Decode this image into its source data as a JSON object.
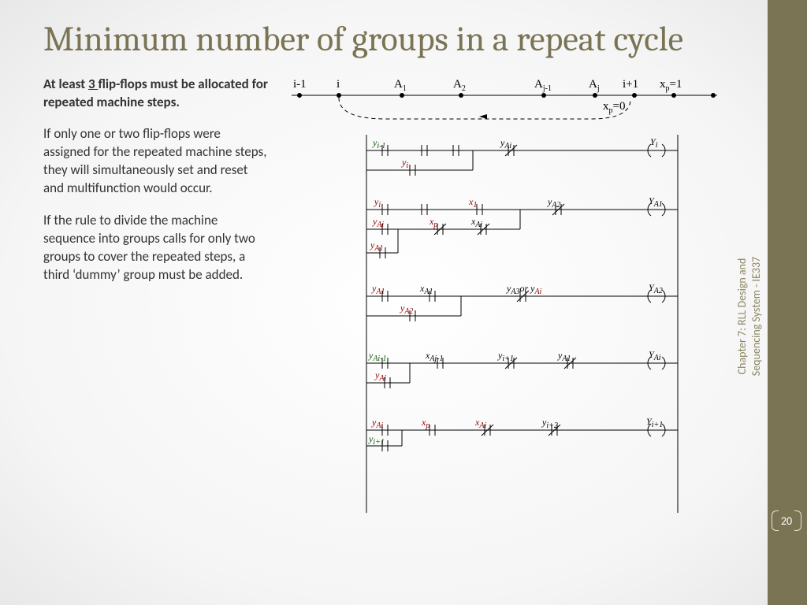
{
  "title": "Minimum number of groups in a repeat cycle",
  "text": {
    "lead_pre": "At least ",
    "lead_num": "3 ",
    "lead_post": "flip-flops must be allocated for repeated machine steps.",
    "p2": "If only one or two flip-flops were assigned for the repeated machine steps, they will simultaneously set and reset and multifunction would occur.",
    "p3": "If the rule to divide the machine sequence into groups calls for only two groups to cover the  repeated steps, a third ‘dummy’ group must be added."
  },
  "timeline": {
    "n0": "i-1",
    "n1": "i",
    "n2": "A",
    "s2": "1",
    "n3": "A",
    "s3": "2",
    "n4": "A",
    "s4": "j-1",
    "n5": "A",
    "s5": "j",
    "n6": "i+1",
    "n7": "x",
    "s7": "p",
    "eq7": "=1",
    "xp0": "x",
    "xp0s": "p",
    "xp0eq": "=0"
  },
  "rungs": {
    "r1": {
      "a": "y",
      "as": "i-1",
      "b": "y",
      "bs": "i",
      "c": "y",
      "cs": "Ai",
      "out": "Y",
      "outs": "i"
    },
    "r2": {
      "a": "y",
      "as": "i",
      "b": "x",
      "bs": "1",
      "c": "y",
      "cs": "A2",
      "out": "Y",
      "outs": "A1",
      "a2": "y",
      "a2s": "Ai",
      "b2": "x",
      "b2s": "p",
      "c2": "x",
      "c2s": "Ai",
      "a3": "y",
      "a3s": "A1"
    },
    "r3": {
      "a": "y",
      "as": "A1",
      "b": "x",
      "bs": "A1",
      "c": "y",
      "cs": "A3",
      "c2": "or y",
      "c2s": "Ai",
      "out": "Y",
      "outs": "A2",
      "a2": "y",
      "a2s": "A2"
    },
    "r4": {
      "a": "y",
      "as": "Ai-1",
      "b": "x",
      "bs": "Aj-1",
      "c": "y",
      "cs": "i+1",
      "d": "y",
      "ds": "A1",
      "out": "Y",
      "outs": "Ai",
      "a2": "y",
      "a2s": "Ai"
    },
    "r5": {
      "a": "y",
      "as": "Ai",
      "b": "x",
      "bs": "p",
      "c": "x",
      "cs": "Ai",
      "d": "y",
      "ds": "i+2",
      "out": "Y",
      "outs": "i+1",
      "a2": "y",
      "a2s": "i+1"
    }
  },
  "sidebar": {
    "line1": "Chapter 7: RLL Design and",
    "line2": "Sequencing System - IE337"
  },
  "page": "20"
}
